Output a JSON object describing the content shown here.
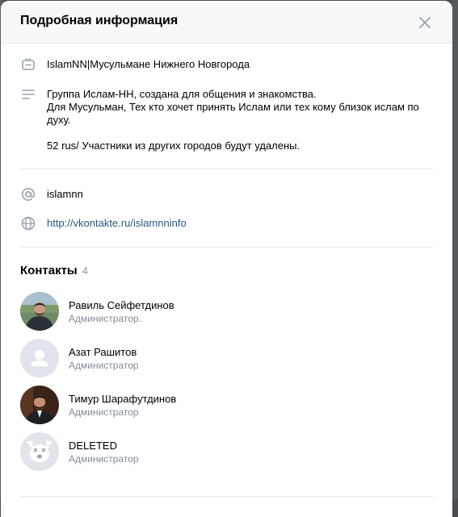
{
  "modal": {
    "title": "Подробная информация"
  },
  "info": {
    "group_name": "IslamNN|Мусульмане Нижнего Новгорода",
    "description_lines": [
      "Группа Ислам-НН, создана для общения и знакомства.",
      "Для Мусульман, Тех кто хочет принять Ислам или тех кому близок ислам по",
      "духу.",
      "",
      "52 rus/ Участники из других городов будут удалены."
    ],
    "short_address": "islamnn",
    "website": "http://vkontakte.ru/islamnninfo"
  },
  "contacts": {
    "title": "Контакты",
    "count": "4",
    "items": [
      {
        "name": "Равиль Сейфетдинов",
        "role": "Администратор.",
        "avatar": "photo"
      },
      {
        "name": "Азат Рашитов",
        "role": "Администратор",
        "avatar": "placeholder"
      },
      {
        "name": "Тимур Шарафутдинов",
        "role": "Администратор",
        "avatar": "photo"
      },
      {
        "name": "DELETED",
        "role": "Администратор",
        "avatar": "deleted-dog"
      }
    ]
  },
  "colors": {
    "link": "#2a5885",
    "secondary": "#818c99",
    "icon": "#99a2ad"
  }
}
